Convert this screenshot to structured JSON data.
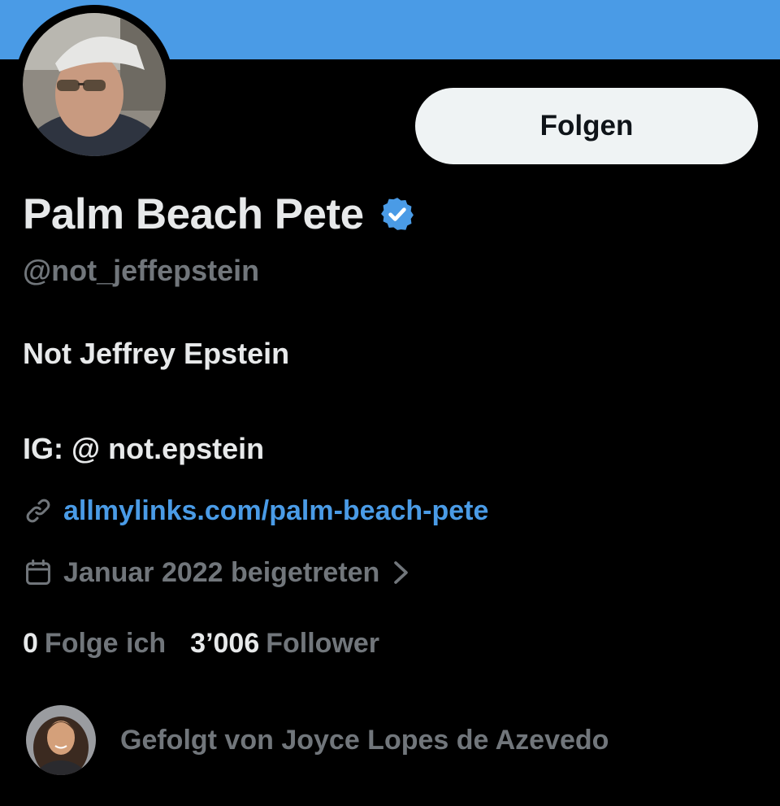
{
  "header": {
    "banner_color": "#4a9be6"
  },
  "profile": {
    "avatar_icon": "profile-photo",
    "display_name": "Palm Beach Pete",
    "verified_icon": "verified-badge-icon",
    "verified_color": "#4a9be6",
    "handle": "@not_jeffepstein",
    "bio_lines": [
      "Not Jeffrey Epstein",
      "IG: @ not.epstein"
    ],
    "link": {
      "icon": "link-icon",
      "text": "allmylinks.com/palm-beach-pete"
    },
    "joined": {
      "icon": "calendar-icon",
      "text": "Januar 2022 beigetreten",
      "chevron_icon": "chevron-right-icon"
    },
    "stats": {
      "following_count": "0",
      "following_label": "Folge ich",
      "followers_count": "3’006",
      "followers_label": "Follower"
    },
    "followed_by": {
      "avatar_icon": "follower-avatar",
      "text": "Gefolgt von Joyce Lopes de Azevedo"
    }
  },
  "actions": {
    "follow_label": "Folgen"
  }
}
